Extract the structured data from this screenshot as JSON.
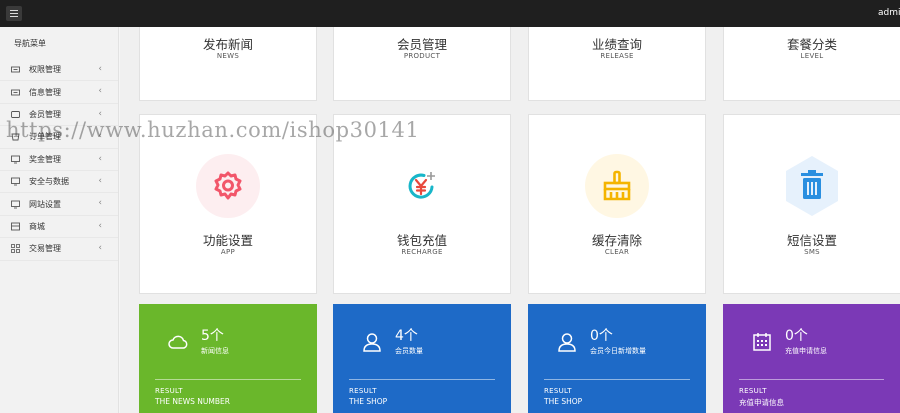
{
  "header": {
    "admin_name": "admin"
  },
  "sidebar": {
    "title": "导航菜单",
    "items": [
      {
        "label": "权限管理",
        "icon": "key-icon"
      },
      {
        "label": "信息管理",
        "icon": "key-icon"
      },
      {
        "label": "会员管理",
        "icon": "user-card-icon"
      },
      {
        "label": "订单管理",
        "icon": "bag-icon"
      },
      {
        "label": "奖金管理",
        "icon": "monitor-icon"
      },
      {
        "label": "安全与数据",
        "icon": "monitor-icon"
      },
      {
        "label": "网站设置",
        "icon": "monitor-icon"
      },
      {
        "label": "商城",
        "icon": "shop-icon"
      },
      {
        "label": "交易管理",
        "icon": "grid-icon"
      }
    ]
  },
  "cards_top": [
    {
      "label": "发布新闻",
      "sub": "NEWS"
    },
    {
      "label": "会员管理",
      "sub": "PRODUCT"
    },
    {
      "label": "业绩查询",
      "sub": "RELEASE"
    },
    {
      "label": "套餐分类",
      "sub": "LEVEL"
    }
  ],
  "cards_mid": [
    {
      "label": "功能设置",
      "sub": "APP",
      "icon": "gear-icon",
      "color": "#f2566a",
      "bg": "#fdeef0"
    },
    {
      "label": "钱包充值",
      "sub": "RECHARGE",
      "icon": "yuan-refresh-icon",
      "color": "#e8483c",
      "bg": "#ffffff"
    },
    {
      "label": "缓存清除",
      "sub": "CLEAR",
      "icon": "broom-icon",
      "color": "#f4b400",
      "bg": "#fff7e3"
    },
    {
      "label": "短信设置",
      "sub": "SMS",
      "icon": "trash-icon",
      "color": "#2a8fe0",
      "bg": "#e6f1fc"
    }
  ],
  "stats": [
    {
      "count": "5个",
      "desc": "新闻信息",
      "result": "RESULT",
      "result_sub": "THE NEWS NUMBER",
      "icon": "cloud-icon",
      "color": "#6ab72b"
    },
    {
      "count": "4个",
      "desc": "会员数量",
      "result": "RESULT",
      "result_sub": "THE SHOP",
      "icon": "user-icon",
      "color": "#1e6ac7"
    },
    {
      "count": "0个",
      "desc": "会员今日新增数量",
      "result": "RESULT",
      "result_sub": "THE SHOP",
      "icon": "user-icon",
      "color": "#1e6ac7"
    },
    {
      "count": "0个",
      "desc": "充值申请信息",
      "result": "RESULT",
      "result_sub": "充值申请信息",
      "icon": "calendar-icon",
      "color": "#7b39b6"
    }
  ],
  "watermark": "https://www.huzhan.com/ishop30141"
}
